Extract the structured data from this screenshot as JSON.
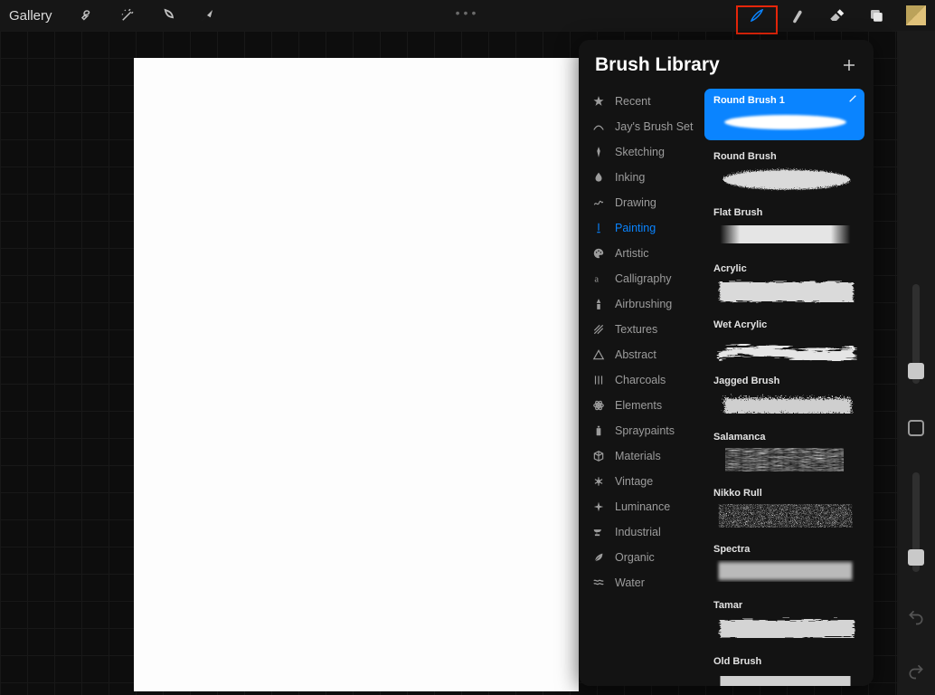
{
  "topbar": {
    "gallery_label": "Gallery"
  },
  "panel": {
    "title": "Brush Library"
  },
  "categories": [
    {
      "label": "Recent",
      "icon": "star"
    },
    {
      "label": "Jay's Brush Set",
      "icon": "stroke"
    },
    {
      "label": "Sketching",
      "icon": "pencil"
    },
    {
      "label": "Inking",
      "icon": "drop"
    },
    {
      "label": "Drawing",
      "icon": "scribble"
    },
    {
      "label": "Painting",
      "icon": "brush",
      "active": true
    },
    {
      "label": "Artistic",
      "icon": "palette"
    },
    {
      "label": "Calligraphy",
      "icon": "a"
    },
    {
      "label": "Airbrushing",
      "icon": "spray"
    },
    {
      "label": "Textures",
      "icon": "hatch"
    },
    {
      "label": "Abstract",
      "icon": "triangle"
    },
    {
      "label": "Charcoals",
      "icon": "lines"
    },
    {
      "label": "Elements",
      "icon": "atom"
    },
    {
      "label": "Spraypaints",
      "icon": "can"
    },
    {
      "label": "Materials",
      "icon": "cube"
    },
    {
      "label": "Vintage",
      "icon": "asterisk"
    },
    {
      "label": "Luminance",
      "icon": "sparkle"
    },
    {
      "label": "Industrial",
      "icon": "anvil"
    },
    {
      "label": "Organic",
      "icon": "leaf"
    },
    {
      "label": "Water",
      "icon": "waves"
    }
  ],
  "brushes": [
    {
      "name": "Round Brush 1",
      "selected": true,
      "style": "soft-round"
    },
    {
      "name": "Round Brush",
      "style": "cloud-round"
    },
    {
      "name": "Flat Brush",
      "style": "flat"
    },
    {
      "name": "Acrylic",
      "style": "acrylic"
    },
    {
      "name": "Wet Acrylic",
      "style": "wet"
    },
    {
      "name": "Jagged Brush",
      "style": "jagged"
    },
    {
      "name": "Salamanca",
      "style": "dry"
    },
    {
      "name": "Nikko Rull",
      "style": "nikko"
    },
    {
      "name": "Spectra",
      "style": "spectra"
    },
    {
      "name": "Tamar",
      "style": "tamar"
    },
    {
      "name": "Old Brush",
      "style": "old"
    }
  ]
}
